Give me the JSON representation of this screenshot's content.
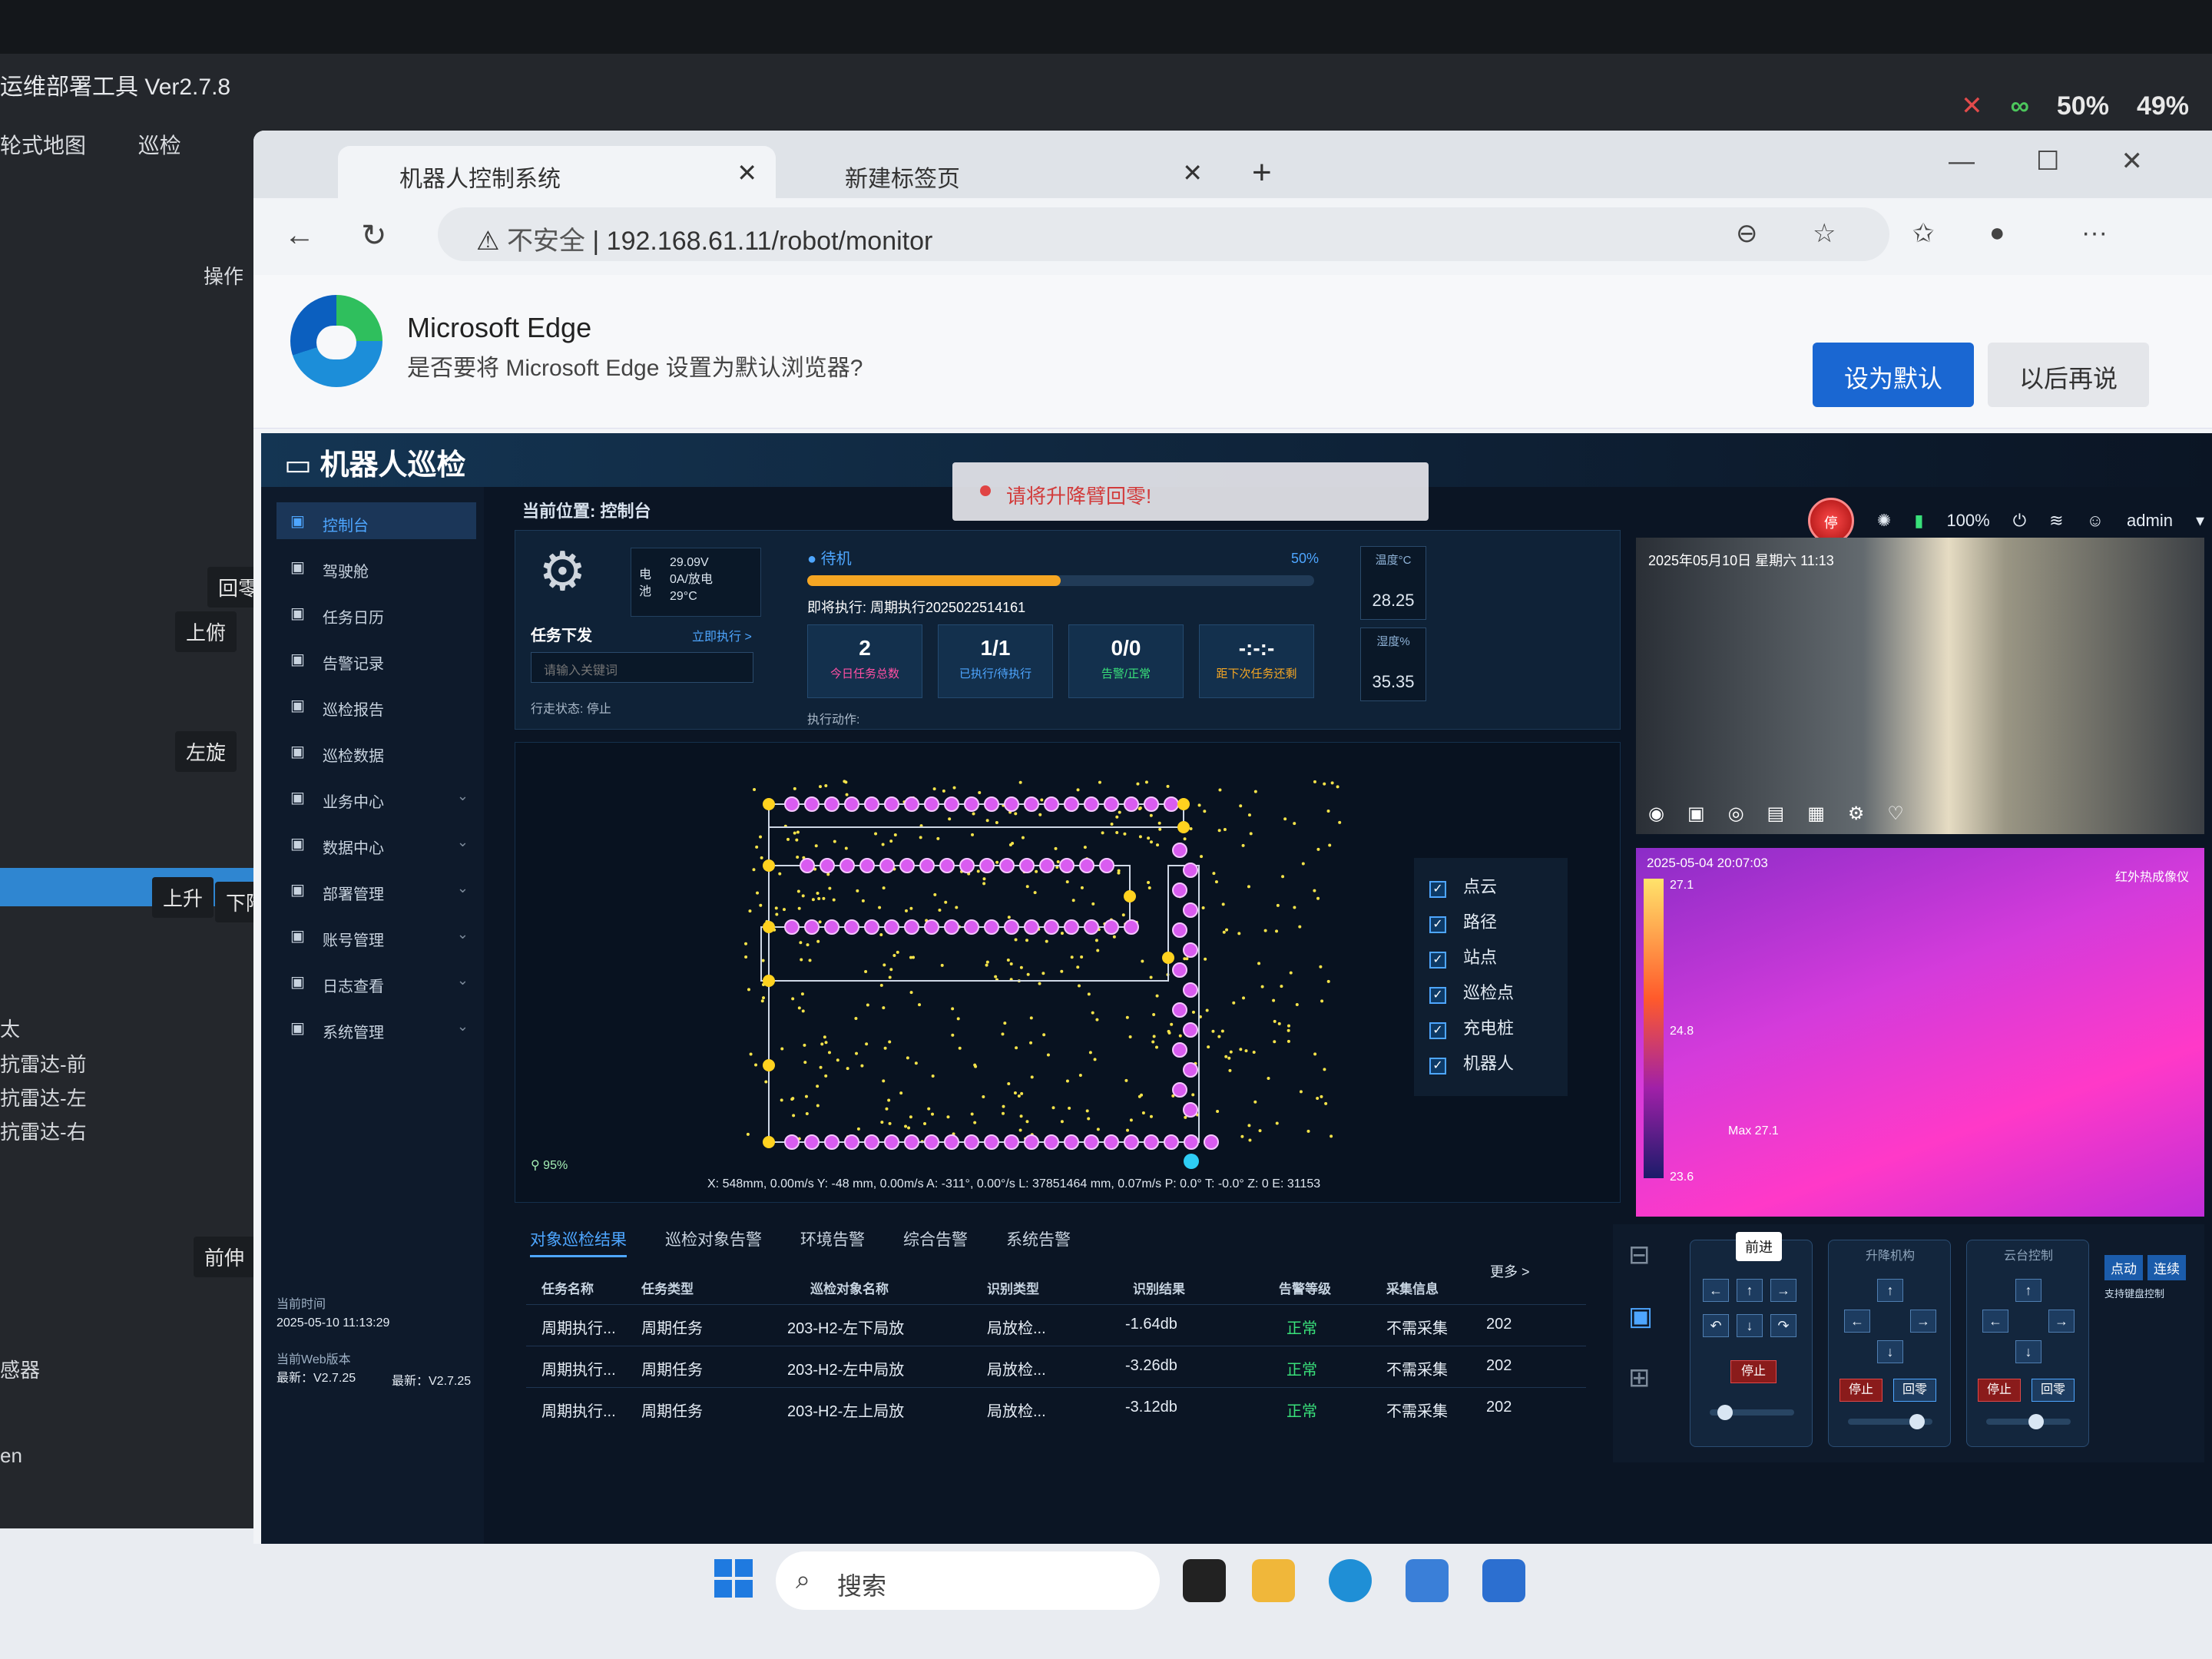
{
  "background": {
    "title": "运维部署工具 Ver2.7.8",
    "nav": [
      "轮式地图",
      "巡检"
    ],
    "operate": "操作",
    "side_buttons": [
      "回零",
      "上俯",
      "左旋",
      "上升",
      "下降",
      "前伸"
    ],
    "side_list": [
      "太",
      "抗雷达-前",
      "抗雷达-左",
      "抗雷达-右",
      "感器",
      "en"
    ],
    "sys": {
      "cpu": "50%",
      "disk": "49%"
    }
  },
  "browser": {
    "tabs": [
      {
        "label": "机器人控制系统"
      },
      {
        "label": "新建标签页"
      }
    ],
    "new_tab": "+",
    "url_warning": "不安全",
    "url": "192.168.61.11/robot/monitor",
    "edge_banner": {
      "title": "Microsoft Edge",
      "message": "是否要将 Microsoft Edge 设置为默认浏览器?",
      "set_default": "设为默认",
      "later": "以后再说"
    }
  },
  "app": {
    "title": "机器人巡检",
    "alert": "请将升降臂回零!",
    "estop": "停",
    "battery_pct": "100%",
    "user": "admin",
    "breadcrumb": "当前位置: 控制台",
    "sidebar": [
      {
        "label": "控制台",
        "icon": "monitor-icon",
        "active": true
      },
      {
        "label": "驾驶舱",
        "icon": "dashboard-icon"
      },
      {
        "label": "任务日历",
        "icon": "calendar-icon"
      },
      {
        "label": "告警记录",
        "icon": "alarm-icon"
      },
      {
        "label": "巡检报告",
        "icon": "report-icon"
      },
      {
        "label": "巡检数据",
        "icon": "data-icon"
      },
      {
        "label": "业务中心",
        "icon": "business-icon",
        "expand": true
      },
      {
        "label": "数据中心",
        "icon": "database-icon",
        "expand": true
      },
      {
        "label": "部署管理",
        "icon": "deploy-icon",
        "expand": true
      },
      {
        "label": "账号管理",
        "icon": "account-icon",
        "expand": true
      },
      {
        "label": "日志查看",
        "icon": "log-icon",
        "expand": true
      },
      {
        "label": "系统管理",
        "icon": "settings-icon",
        "expand": true
      }
    ],
    "sidefoot": {
      "time_label": "当前时间",
      "time": "2025-05-10 11:13:29",
      "web_label": "当前Web版本",
      "ver_new": "最新：V2.7.25",
      "ver_cur": "最新：V2.7.25"
    },
    "robot": {
      "voltage": "29.09V",
      "current": "0A/放电",
      "temp": "29°C",
      "battery_label": "电池"
    },
    "task": {
      "header": "任务下发",
      "run_now": "立即执行 >",
      "input_placeholder": "请输入关键词",
      "walk_state": "行走状态: 停止"
    },
    "status": {
      "state": "待机",
      "progress_pct": 50,
      "progress_label": "50%",
      "next_exec": "即将执行: 周期执行2025022514161",
      "exec_action": "执行动作:"
    },
    "stats": [
      {
        "value": "2",
        "label": "今日任务总数",
        "color": "#ff4fa3"
      },
      {
        "value": "1/1",
        "label": "已执行/待执行",
        "color": "#4ea6ff"
      },
      {
        "value": "0/0",
        "label": "告警/正常",
        "color": "#39e07a"
      },
      {
        "value": "-:-:-",
        "label": "距下次任务还剩",
        "color": "#f5a623"
      }
    ],
    "env": {
      "temp_label": "温度°C",
      "temp": "28.25",
      "hum_label": "湿度%",
      "hum": "35.35"
    },
    "camera": {
      "stamp": "2025年05月10日 星期六 11:13"
    },
    "thermal": {
      "stamp": "2025-05-04 20:07:03",
      "label": "红外热成像仪",
      "t_max": "27.1",
      "t_mid": "24.8",
      "t_min": "23.6",
      "max_marker": "Max 27.1"
    },
    "map": {
      "legend": [
        {
          "label": "点云",
          "checked": true
        },
        {
          "label": "路径",
          "checked": true
        },
        {
          "label": "站点",
          "checked": true
        },
        {
          "label": "巡检点",
          "checked": true
        },
        {
          "label": "充电桩",
          "checked": true
        },
        {
          "label": "机器人",
          "checked": true
        }
      ],
      "info": "X: 548mm, 0.00m/s  Y: -48 mm, 0.00m/s  A: -311°, 0.00°/s  L: 37851464 mm, 0.07m/s  P: 0.0°  T: -0.0°  Z: 0  E: 31153",
      "signal": "95%"
    },
    "tabs": [
      "对象巡检结果",
      "巡检对象告警",
      "环境告警",
      "综合告警",
      "系统告警"
    ],
    "more": "更多 >",
    "table": {
      "headers": [
        "任务名称",
        "任务类型",
        "巡检对象名称",
        "识别类型",
        "识别结果",
        "告警等级",
        "采集信息"
      ],
      "rows": [
        [
          "周期执行...",
          "周期任务",
          "203-H2-左下局放",
          "局放检...",
          "-1.64db",
          "正常",
          "不需采集",
          "202"
        ],
        [
          "周期执行...",
          "周期任务",
          "203-H2-左中局放",
          "局放检...",
          "-3.26db",
          "正常",
          "不需采集",
          "202"
        ],
        [
          "周期执行...",
          "周期任务",
          "203-H2-左上局放",
          "局放检...",
          "-3.12db",
          "正常",
          "不需采集",
          "202"
        ]
      ]
    },
    "controls": {
      "tooltip": "前进",
      "stop": "停止",
      "zero": "回零",
      "group2": "升降机构",
      "group3": "云台控制",
      "point_mode": [
        "点动",
        "连续"
      ],
      "point_note": "支持键盘控制"
    }
  }
}
